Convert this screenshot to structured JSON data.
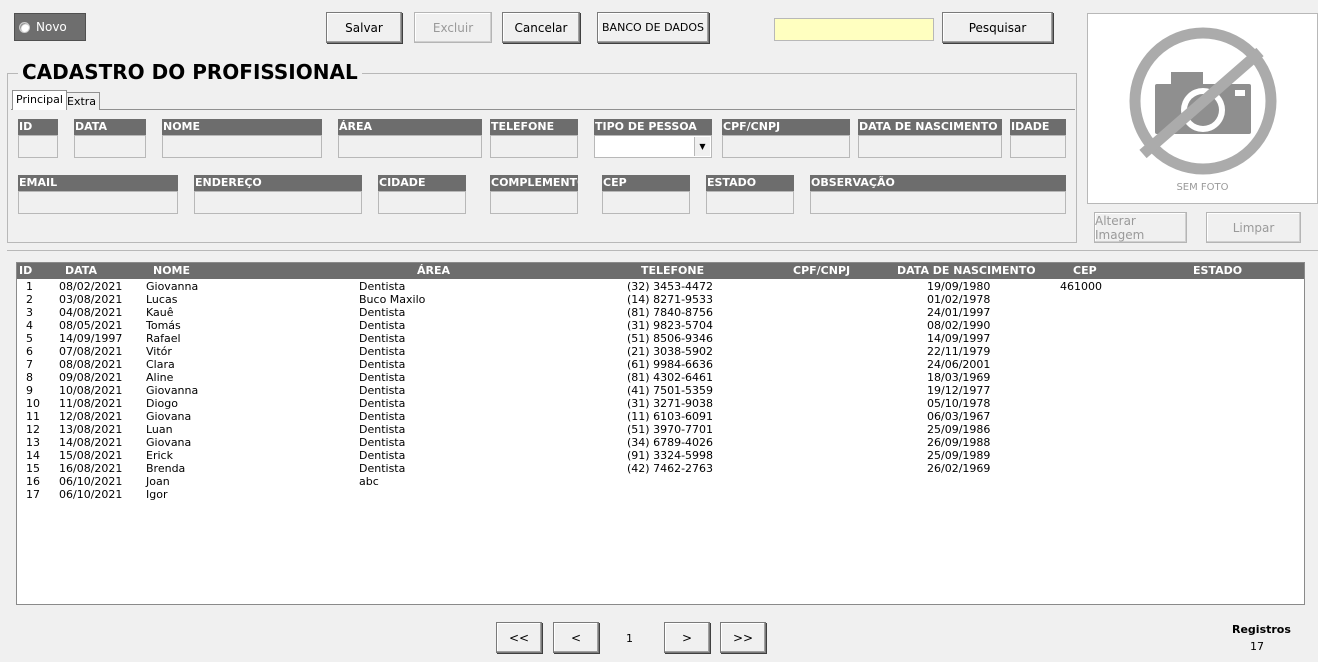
{
  "toolbar": {
    "novo_label": "Novo",
    "salvar_label": "Salvar",
    "excluir_label": "Excluir",
    "cancelar_label": "Cancelar",
    "banco_label": "BANCO DE DADOS",
    "search_value": "",
    "pesquisar_label": "Pesquisar"
  },
  "form": {
    "title": "CADASTRO DO PROFISSIONAL",
    "tabs": [
      {
        "label": "Principal"
      },
      {
        "label": "Extra"
      }
    ],
    "fields": {
      "id": "ID",
      "data": "DATA",
      "nome": "NOME",
      "area": "ÁREA",
      "telefone": "TELEFONE",
      "tipo_pessoa": "TIPO DE PESSOA",
      "cpf_cnpj": "CPF/CNPJ",
      "data_nascimento": "DATA DE NASCIMENTO",
      "idade": "IDADE",
      "email": "EMAIL",
      "endereco": "ENDEREÇO",
      "cidade": "CIDADE",
      "complemento": "COMPLEMENTO",
      "cep": "CEP",
      "estado": "ESTADO",
      "observacao": "OBSERVAÇÃO"
    }
  },
  "photo": {
    "caption": "SEM FOTO",
    "alterar_label": "Alterar Imagem",
    "limpar_label": "Limpar"
  },
  "table": {
    "headers": {
      "id": "ID",
      "data": "DATA",
      "nome": "NOME",
      "area": "ÁREA",
      "telefone": "TELEFONE",
      "cpf": "CPF/CNPJ",
      "nasc": "DATA DE NASCIMENTO",
      "cep": "CEP",
      "estado": "ESTADO"
    },
    "rows": [
      {
        "id": "1",
        "data": "08/02/2021",
        "nome": "Giovanna",
        "area": "Dentista",
        "tel": "(32) 3453-4472",
        "nasc": "19/09/1980",
        "cep": "461000"
      },
      {
        "id": "2",
        "data": "03/08/2021",
        "nome": "Lucas",
        "area": "Buco Maxilo",
        "tel": "(14) 8271-9533",
        "nasc": "01/02/1978",
        "cep": ""
      },
      {
        "id": "3",
        "data": "04/08/2021",
        "nome": "Kauê",
        "area": "Dentista",
        "tel": "(81) 7840-8756",
        "nasc": "24/01/1997",
        "cep": ""
      },
      {
        "id": "4",
        "data": "08/05/2021",
        "nome": "Tomás",
        "area": "Dentista",
        "tel": "(31) 9823-5704",
        "nasc": "08/02/1990",
        "cep": ""
      },
      {
        "id": "5",
        "data": "14/09/1997",
        "nome": "Rafael",
        "area": "Dentista",
        "tel": "(51) 8506-9346",
        "nasc": "14/09/1997",
        "cep": ""
      },
      {
        "id": "6",
        "data": "07/08/2021",
        "nome": "Vitór",
        "area": "Dentista",
        "tel": "(21) 3038-5902",
        "nasc": "22/11/1979",
        "cep": ""
      },
      {
        "id": "7",
        "data": "08/08/2021",
        "nome": "Clara",
        "area": "Dentista",
        "tel": "(61) 9984-6636",
        "nasc": "24/06/2001",
        "cep": ""
      },
      {
        "id": "8",
        "data": "09/08/2021",
        "nome": "Aline",
        "area": "Dentista",
        "tel": "(81) 4302-6461",
        "nasc": "18/03/1969",
        "cep": ""
      },
      {
        "id": "9",
        "data": "10/08/2021",
        "nome": "Giovanna",
        "area": "Dentista",
        "tel": "(41) 7501-5359",
        "nasc": "19/12/1977",
        "cep": ""
      },
      {
        "id": "10",
        "data": "11/08/2021",
        "nome": "Diogo",
        "area": "Dentista",
        "tel": "(31) 3271-9038",
        "nasc": "05/10/1978",
        "cep": ""
      },
      {
        "id": "11",
        "data": "12/08/2021",
        "nome": "Giovana",
        "area": "Dentista",
        "tel": "(11) 6103-6091",
        "nasc": "06/03/1967",
        "cep": ""
      },
      {
        "id": "12",
        "data": "13/08/2021",
        "nome": "Luan",
        "area": "Dentista",
        "tel": "(51) 3970-7701",
        "nasc": "25/09/1986",
        "cep": ""
      },
      {
        "id": "13",
        "data": "14/08/2021",
        "nome": "Giovana",
        "area": "Dentista",
        "tel": "(34) 6789-4026",
        "nasc": "26/09/1988",
        "cep": ""
      },
      {
        "id": "14",
        "data": "15/08/2021",
        "nome": "Erick",
        "area": "Dentista",
        "tel": "(91) 3324-5998",
        "nasc": "25/09/1989",
        "cep": ""
      },
      {
        "id": "15",
        "data": "16/08/2021",
        "nome": "Brenda",
        "area": "Dentista",
        "tel": "(42) 7462-2763",
        "nasc": "26/02/1969",
        "cep": ""
      },
      {
        "id": "16",
        "data": "06/10/2021",
        "nome": "Joan",
        "area": "abc",
        "tel": "",
        "nasc": "",
        "cep": ""
      },
      {
        "id": "17",
        "data": "06/10/2021",
        "nome": "Igor",
        "area": "",
        "tel": "",
        "nasc": "",
        "cep": ""
      }
    ]
  },
  "pager": {
    "first_label": "<<",
    "prev_label": "<",
    "page": "1",
    "next_label": ">",
    "last_label": ">>"
  },
  "registros": {
    "label": "Registros",
    "count": "17"
  }
}
